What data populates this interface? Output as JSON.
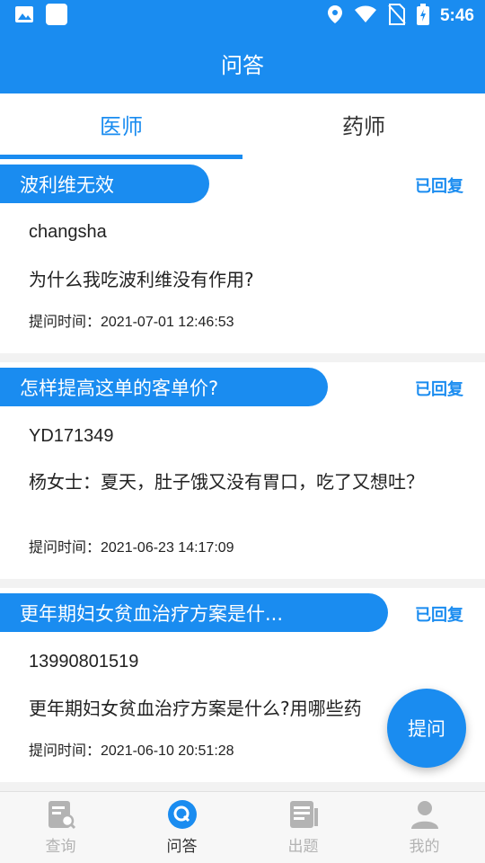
{
  "status_bar": {
    "time": "5:46"
  },
  "app_bar": {
    "title": "问答"
  },
  "tabs": [
    {
      "label": "医师",
      "active": true
    },
    {
      "label": "药师",
      "active": false
    }
  ],
  "questions": [
    {
      "title": "波利维无效",
      "status": "已回复",
      "user": "changsha",
      "question": "为什么我吃波利维没有作用?",
      "time": "提问时间：2021-07-01 12:46:53"
    },
    {
      "title": "怎样提高这单的客单价?",
      "status": "已回复",
      "user": "YD171349",
      "question": "杨女士：夏天，肚子饿又没有胃口，吃了又想吐？",
      "time": "提问时间：2021-06-23 14:17:09"
    },
    {
      "title": "更年期妇女贫血治疗方案是什...",
      "status": "已回复",
      "user": "13990801519",
      "question": "更年期妇女贫血治疗方案是什么?用哪些药",
      "time": "提问时间：2021-06-10 20:51:28"
    }
  ],
  "fab": {
    "label": "提问"
  },
  "bottom_nav": [
    {
      "label": "查询",
      "icon": "search-doc-icon",
      "active": false
    },
    {
      "label": "问答",
      "icon": "qa-icon",
      "active": true
    },
    {
      "label": "出题",
      "icon": "exam-icon",
      "active": false
    },
    {
      "label": "我的",
      "icon": "profile-icon",
      "active": false
    }
  ],
  "colors": {
    "primary": "#1a8cf0",
    "background": "#f2f2f2",
    "nav_inactive": "#b3b3b3"
  }
}
